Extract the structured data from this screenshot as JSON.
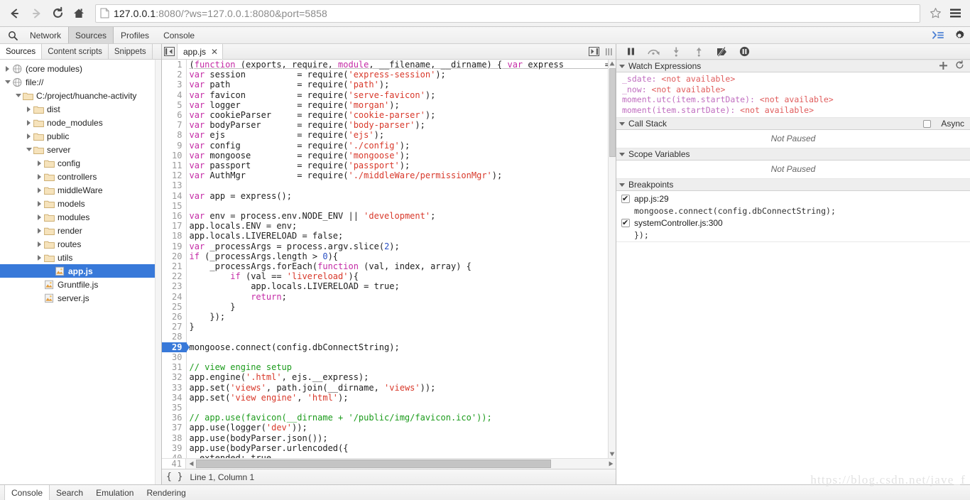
{
  "browser": {
    "back_icon": "arrow-left-icon",
    "forward_icon": "arrow-right-icon",
    "reload_icon": "reload-icon",
    "home_icon": "home-icon",
    "page_icon": "page-document-icon",
    "url_bold": "127.0.0.1",
    "url_rest": ":8080/?ws=127.0.0.1:8080&port=5858",
    "url_full": "127.0.0.1:8080/?ws=127.0.0.1:8080&port=5858",
    "star_icon": "star-bookmark-icon",
    "menu_icon": "hamburger-menu-icon"
  },
  "devtools": {
    "search_icon": "search-icon",
    "tabs": [
      {
        "label": "Network",
        "active": false
      },
      {
        "label": "Sources",
        "active": true
      },
      {
        "label": "Profiles",
        "active": false
      },
      {
        "label": "Console",
        "active": false
      }
    ],
    "console_prompt_icon": "console-prompt-icon",
    "settings_icon": "gear-icon"
  },
  "navigator": {
    "tabs": [
      {
        "label": "Sources",
        "active": true
      },
      {
        "label": "Content scripts",
        "active": false
      },
      {
        "label": "Snippets",
        "active": false
      }
    ],
    "tree": [
      {
        "label": "(core modules)",
        "indent": 0,
        "twisty": "closed",
        "icon": "globe-icon",
        "selected": false
      },
      {
        "label": "file://",
        "indent": 0,
        "twisty": "open",
        "icon": "globe-icon",
        "selected": false
      },
      {
        "label": "C:/project/huanche-activity",
        "indent": 1,
        "twisty": "open",
        "icon": "folder-icon",
        "selected": false
      },
      {
        "label": "dist",
        "indent": 2,
        "twisty": "closed",
        "icon": "folder-icon",
        "selected": false
      },
      {
        "label": "node_modules",
        "indent": 2,
        "twisty": "closed",
        "icon": "folder-icon",
        "selected": false
      },
      {
        "label": "public",
        "indent": 2,
        "twisty": "closed",
        "icon": "folder-icon",
        "selected": false
      },
      {
        "label": "server",
        "indent": 2,
        "twisty": "open",
        "icon": "folder-icon",
        "selected": false
      },
      {
        "label": "config",
        "indent": 3,
        "twisty": "closed",
        "icon": "folder-icon",
        "selected": false
      },
      {
        "label": "controllers",
        "indent": 3,
        "twisty": "closed",
        "icon": "folder-icon",
        "selected": false
      },
      {
        "label": "middleWare",
        "indent": 3,
        "twisty": "closed",
        "icon": "folder-icon",
        "selected": false
      },
      {
        "label": "models",
        "indent": 3,
        "twisty": "closed",
        "icon": "folder-icon",
        "selected": false
      },
      {
        "label": "modules",
        "indent": 3,
        "twisty": "closed",
        "icon": "folder-icon",
        "selected": false
      },
      {
        "label": "render",
        "indent": 3,
        "twisty": "closed",
        "icon": "folder-icon",
        "selected": false
      },
      {
        "label": "routes",
        "indent": 3,
        "twisty": "closed",
        "icon": "folder-icon",
        "selected": false
      },
      {
        "label": "utils",
        "indent": 3,
        "twisty": "closed",
        "icon": "folder-icon",
        "selected": false
      },
      {
        "label": "app.js",
        "indent": 4,
        "twisty": "none",
        "icon": "js-file-icon",
        "selected": true
      },
      {
        "label": "Gruntfile.js",
        "indent": 3,
        "twisty": "none",
        "icon": "js-file-icon",
        "selected": false
      },
      {
        "label": "server.js",
        "indent": 3,
        "twisty": "none",
        "icon": "js-file-icon",
        "selected": false
      }
    ]
  },
  "editor": {
    "collapse_icon": "collapse-sidebar-icon",
    "file_tab": {
      "label": "app.js",
      "close_label": "✕"
    },
    "expand_icon": "expand-sidebar-icon",
    "more_icon": "more-vertical-icon",
    "breakpoint_line": 29,
    "status": {
      "pretty_print_icon": "{ }",
      "text": "Line 1, Column 1"
    },
    "lines": [
      {
        "n": 1,
        "tokens": [
          [
            "def",
            "("
          ],
          [
            "kw",
            "function"
          ],
          [
            "def",
            " (exports, require, "
          ],
          [
            "kw",
            "module"
          ],
          [
            "def",
            ", __filename, __dirname) { "
          ],
          [
            "kw",
            "var"
          ],
          [
            "def",
            " express        = requir"
          ]
        ]
      },
      {
        "n": 2,
        "tokens": [
          [
            "kw",
            "var"
          ],
          [
            "def",
            " session          = require("
          ],
          [
            "str",
            "'express-session'"
          ],
          [
            "def",
            ");"
          ]
        ]
      },
      {
        "n": 3,
        "tokens": [
          [
            "kw",
            "var"
          ],
          [
            "def",
            " path             = require("
          ],
          [
            "str",
            "'path'"
          ],
          [
            "def",
            ");"
          ]
        ]
      },
      {
        "n": 4,
        "tokens": [
          [
            "kw",
            "var"
          ],
          [
            "def",
            " favicon          = require("
          ],
          [
            "str",
            "'serve-favicon'"
          ],
          [
            "def",
            ");"
          ]
        ]
      },
      {
        "n": 5,
        "tokens": [
          [
            "kw",
            "var"
          ],
          [
            "def",
            " logger           = require("
          ],
          [
            "str",
            "'morgan'"
          ],
          [
            "def",
            ");"
          ]
        ]
      },
      {
        "n": 6,
        "tokens": [
          [
            "kw",
            "var"
          ],
          [
            "def",
            " cookieParser     = require("
          ],
          [
            "str",
            "'cookie-parser'"
          ],
          [
            "def",
            ");"
          ]
        ]
      },
      {
        "n": 7,
        "tokens": [
          [
            "kw",
            "var"
          ],
          [
            "def",
            " bodyParser       = require("
          ],
          [
            "str",
            "'body-parser'"
          ],
          [
            "def",
            ");"
          ]
        ]
      },
      {
        "n": 8,
        "tokens": [
          [
            "kw",
            "var"
          ],
          [
            "def",
            " ejs              = require("
          ],
          [
            "str",
            "'ejs'"
          ],
          [
            "def",
            ");"
          ]
        ]
      },
      {
        "n": 9,
        "tokens": [
          [
            "kw",
            "var"
          ],
          [
            "def",
            " config           = require("
          ],
          [
            "str",
            "'./config'"
          ],
          [
            "def",
            ");"
          ]
        ]
      },
      {
        "n": 10,
        "tokens": [
          [
            "kw",
            "var"
          ],
          [
            "def",
            " mongoose         = require("
          ],
          [
            "str",
            "'mongoose'"
          ],
          [
            "def",
            ");"
          ]
        ]
      },
      {
        "n": 11,
        "tokens": [
          [
            "kw",
            "var"
          ],
          [
            "def",
            " passport         = require("
          ],
          [
            "str",
            "'passport'"
          ],
          [
            "def",
            ");"
          ]
        ]
      },
      {
        "n": 12,
        "tokens": [
          [
            "kw",
            "var"
          ],
          [
            "def",
            " AuthMgr          = require("
          ],
          [
            "str",
            "'./middleWare/permissionMgr'"
          ],
          [
            "def",
            ");"
          ]
        ]
      },
      {
        "n": 13,
        "tokens": []
      },
      {
        "n": 14,
        "tokens": [
          [
            "kw",
            "var"
          ],
          [
            "def",
            " app = express();"
          ]
        ]
      },
      {
        "n": 15,
        "tokens": []
      },
      {
        "n": 16,
        "tokens": [
          [
            "kw",
            "var"
          ],
          [
            "def",
            " env = process.env.NODE_ENV || "
          ],
          [
            "str",
            "'development'"
          ],
          [
            "def",
            ";"
          ]
        ]
      },
      {
        "n": 17,
        "tokens": [
          [
            "def",
            "app.locals.ENV = env;"
          ]
        ]
      },
      {
        "n": 18,
        "tokens": [
          [
            "def",
            "app.locals.LIVERELOAD = false;"
          ]
        ]
      },
      {
        "n": 19,
        "tokens": [
          [
            "kw",
            "var"
          ],
          [
            "def",
            " _processArgs = process.argv.slice("
          ],
          [
            "num",
            "2"
          ],
          [
            "def",
            ");"
          ]
        ]
      },
      {
        "n": 20,
        "tokens": [
          [
            "kw",
            "if"
          ],
          [
            "def",
            " (_processArgs.length > "
          ],
          [
            "num",
            "0"
          ],
          [
            "def",
            "){"
          ]
        ]
      },
      {
        "n": 21,
        "tokens": [
          [
            "def",
            "    _processArgs.forEach("
          ],
          [
            "kw",
            "function"
          ],
          [
            "def",
            " (val, index, array) {"
          ]
        ]
      },
      {
        "n": 22,
        "tokens": [
          [
            "def",
            "        "
          ],
          [
            "kw",
            "if"
          ],
          [
            "def",
            " (val == "
          ],
          [
            "str",
            "'livereload'"
          ],
          [
            "def",
            "){"
          ]
        ]
      },
      {
        "n": 23,
        "tokens": [
          [
            "def",
            "            app.locals.LIVERELOAD = true;"
          ]
        ]
      },
      {
        "n": 24,
        "tokens": [
          [
            "def",
            "            "
          ],
          [
            "kw",
            "return"
          ],
          [
            "def",
            ";"
          ]
        ]
      },
      {
        "n": 25,
        "tokens": [
          [
            "def",
            "        }"
          ]
        ]
      },
      {
        "n": 26,
        "tokens": [
          [
            "def",
            "    });"
          ]
        ]
      },
      {
        "n": 27,
        "tokens": [
          [
            "def",
            "}"
          ]
        ]
      },
      {
        "n": 28,
        "tokens": []
      },
      {
        "n": 29,
        "tokens": [
          [
            "def",
            "mongoose.connect(config.dbConnectString);"
          ]
        ],
        "breakpoint": true
      },
      {
        "n": 30,
        "tokens": []
      },
      {
        "n": 31,
        "tokens": [
          [
            "com",
            "// view engine setup"
          ]
        ]
      },
      {
        "n": 32,
        "tokens": [
          [
            "def",
            "app.engine("
          ],
          [
            "str",
            "'.html'"
          ],
          [
            "def",
            ", ejs.__express);"
          ]
        ]
      },
      {
        "n": 33,
        "tokens": [
          [
            "def",
            "app.set("
          ],
          [
            "str",
            "'views'"
          ],
          [
            "def",
            ", path.join(__dirname, "
          ],
          [
            "str",
            "'views'"
          ],
          [
            "def",
            "));"
          ]
        ]
      },
      {
        "n": 34,
        "tokens": [
          [
            "def",
            "app.set("
          ],
          [
            "str",
            "'view engine'"
          ],
          [
            "def",
            ", "
          ],
          [
            "str",
            "'html'"
          ],
          [
            "def",
            ");"
          ]
        ]
      },
      {
        "n": 35,
        "tokens": []
      },
      {
        "n": 36,
        "tokens": [
          [
            "com",
            "// app.use(favicon(__dirname + '/public/img/favicon.ico'));"
          ]
        ]
      },
      {
        "n": 37,
        "tokens": [
          [
            "def",
            "app.use(logger("
          ],
          [
            "str",
            "'dev'"
          ],
          [
            "def",
            "));"
          ]
        ]
      },
      {
        "n": 38,
        "tokens": [
          [
            "def",
            "app.use(bodyParser.json());"
          ]
        ]
      },
      {
        "n": 39,
        "tokens": [
          [
            "def",
            "app.use(bodyParser.urlencoded({"
          ]
        ]
      },
      {
        "n": 40,
        "tokens": [
          [
            "def",
            "  extended: true"
          ]
        ]
      }
    ],
    "last_line_number": 41
  },
  "debugger": {
    "controls": [
      {
        "name": "pause-resume-button",
        "icon": "pause-icon"
      },
      {
        "name": "step-over-button",
        "icon": "step-over-icon"
      },
      {
        "name": "step-into-button",
        "icon": "step-into-icon"
      },
      {
        "name": "step-out-button",
        "icon": "step-out-icon"
      },
      {
        "name": "deactivate-breakpoints-button",
        "icon": "breakpoint-slash-icon"
      },
      {
        "name": "pause-on-exceptions-button",
        "icon": "pause-circle-icon"
      }
    ],
    "watch": {
      "title": "Watch Expressions",
      "add_icon": "plus-icon",
      "refresh_icon": "refresh-icon",
      "rows": [
        {
          "name": "_sdate:",
          "value": "<not available>"
        },
        {
          "name": "_now:",
          "value": "<not available>"
        },
        {
          "name": "moment.utc(item.startDate):",
          "value": "<not available>"
        },
        {
          "name": "moment(item.startDate):",
          "value": "<not available>"
        }
      ]
    },
    "call_stack": {
      "title": "Call Stack",
      "async_label": "Async",
      "empty_text": "Not Paused"
    },
    "scope": {
      "title": "Scope Variables",
      "empty_text": "Not Paused"
    },
    "breakpoints": {
      "title": "Breakpoints",
      "items": [
        {
          "location": "app.js:29",
          "code": "mongoose.connect(config.dbConnectString);",
          "checked": true
        },
        {
          "location": "systemController.js:300",
          "code": "});",
          "checked": true
        }
      ]
    }
  },
  "drawer": {
    "tabs": [
      {
        "label": "Console",
        "active": true
      },
      {
        "label": "Search",
        "active": false
      },
      {
        "label": "Emulation",
        "active": false
      },
      {
        "label": "Rendering",
        "active": false
      }
    ]
  },
  "watermark": "https://blog.csdn.net/jave_f"
}
